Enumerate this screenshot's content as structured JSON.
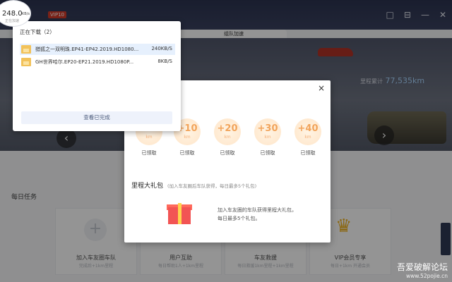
{
  "app": {
    "vip_badge": "VIP10",
    "tab_title": "组队加速",
    "window_controls": [
      "□",
      "⊟",
      "—",
      "✕"
    ],
    "mileage_label": "里程累计",
    "mileage_value": "77,535km"
  },
  "download_popup": {
    "header": "正在下载（2）",
    "items": [
      {
        "name": "猎狐之一双明珠.EP41-EP42.2019.HD1080...",
        "speed": "240KB/S",
        "selected": true
      },
      {
        "name": "GH世界哈尔.EP20-EP21.2019.HD1080P...",
        "speed": "8KB/S",
        "selected": false
      }
    ],
    "view_completed": "查看已完成"
  },
  "speed_indicator": {
    "value": "248.0",
    "unit": "KB/s",
    "sub": "正在加速"
  },
  "modal": {
    "close": "×",
    "rewards": [
      {
        "amount": "+10",
        "unit": "km",
        "state": "已领取"
      },
      {
        "amount": "+10",
        "unit": "km",
        "state": "已领取"
      },
      {
        "amount": "+20",
        "unit": "km",
        "state": "已领取"
      },
      {
        "amount": "+30",
        "unit": "km",
        "state": "已领取"
      },
      {
        "amount": "+40",
        "unit": "km",
        "state": "已领取"
      }
    ],
    "milestone_title": "里程大礼包",
    "milestone_hint": "(加入车友圈后车队获得，每日最多5个礼包)",
    "gift_text_1": "加入车友圈的车队获得里程大礼包，",
    "gift_text_2": "每日最多5个礼包。"
  },
  "tasks": {
    "title": "每日任务",
    "cards": [
      {
        "label": "加入车友圈车队",
        "sub": "完成后+1km里程",
        "icon": "+"
      },
      {
        "label": "用户互助",
        "sub": "每日帮助1人+1km里程",
        "icon": ""
      },
      {
        "label": "车友救援",
        "sub": "每日救援1km里程+1km里程",
        "icon": ""
      },
      {
        "label": "VIP会员专享",
        "sub": "每日+1km 开通会员",
        "icon": "♛"
      }
    ]
  },
  "watermark": {
    "line1": "吾爱破解论坛",
    "line2": "www.52pojie.cn"
  },
  "colors": {
    "titlebar": "#2c3350",
    "reward_coin": "#ffe5c8",
    "reward_text": "#f2a45b",
    "gift": "#f25454"
  }
}
